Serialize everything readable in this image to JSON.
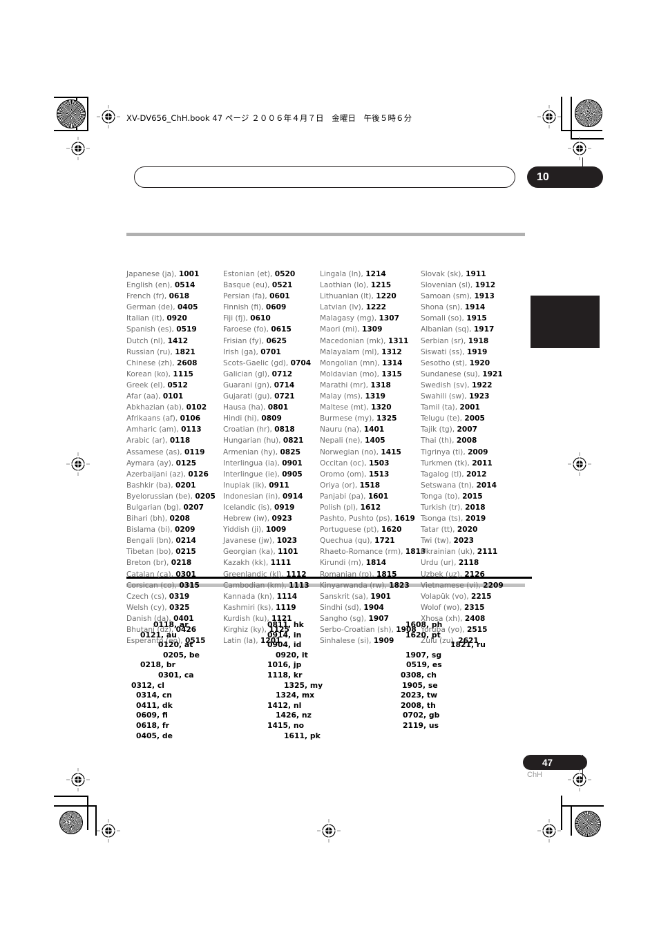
{
  "header": {
    "running_head": "XV-DV656_ChH.book 47 ページ  ２００６年４月７日　金曜日　午後５時６分"
  },
  "chapter": {
    "number": "10",
    "title": ""
  },
  "footer": {
    "page_number": "47",
    "page_lang_code": "ChH"
  },
  "language_table": {
    "columns": [
      {
        "rows": [
          {
            "name": "Japanese (ja), ",
            "code": "1001"
          },
          {
            "name": "English (en), ",
            "code": "0514"
          },
          {
            "name": "French (fr), ",
            "code": "0618"
          },
          {
            "name": "German (de), ",
            "code": "0405"
          },
          {
            "name": "Italian (it), ",
            "code": "0920"
          },
          {
            "name": "Spanish (es), ",
            "code": "0519"
          },
          {
            "name": "Dutch (nl), ",
            "code": "1412"
          },
          {
            "name": "Russian (ru), ",
            "code": "1821"
          },
          {
            "name": "Chinese (zh), ",
            "code": "2608"
          },
          {
            "name": "Korean (ko), ",
            "code": "1115"
          },
          {
            "name": "Greek (el), ",
            "code": "0512"
          },
          {
            "name": "Afar (aa), ",
            "code": "0101"
          },
          {
            "name": "Abkhazian (ab), ",
            "code": "0102"
          },
          {
            "name": "Afrikaans (af), ",
            "code": "0106"
          },
          {
            "name": "Amharic (am), ",
            "code": "0113"
          },
          {
            "name": "Arabic (ar), ",
            "code": "0118"
          },
          {
            "name": "Assamese (as), ",
            "code": "0119"
          },
          {
            "name": "Aymara (ay), ",
            "code": "0125"
          },
          {
            "name": "Azerbaijani (az), ",
            "code": "0126"
          },
          {
            "name": "Bashkir (ba), ",
            "code": "0201"
          },
          {
            "name": "Byelorussian (be), ",
            "code": "0205"
          },
          {
            "name": "Bulgarian (bg), ",
            "code": "0207"
          },
          {
            "name": "Bihari (bh), ",
            "code": "0208"
          },
          {
            "name": "Bislama (bi), ",
            "code": "0209"
          },
          {
            "name": "Bengali (bn), ",
            "code": "0214"
          },
          {
            "name": "Tibetan (bo), ",
            "code": "0215"
          },
          {
            "name": "Breton (br), ",
            "code": "0218"
          },
          {
            "name": "Catalan (ca), ",
            "code": "0301"
          },
          {
            "name": "Corsican (co), ",
            "code": "0315"
          },
          {
            "name": "Czech (cs), ",
            "code": "0319"
          },
          {
            "name": "Welsh (cy), ",
            "code": "0325"
          },
          {
            "name": "Danish (da), ",
            "code": "0401"
          },
          {
            "name": "Bhutani (dz), ",
            "code": "0426"
          },
          {
            "name": "Esperanto (eo), ",
            "code": "0515"
          }
        ]
      },
      {
        "rows": [
          {
            "name": "Estonian (et), ",
            "code": "0520"
          },
          {
            "name": "Basque (eu), ",
            "code": "0521"
          },
          {
            "name": "Persian (fa), ",
            "code": "0601"
          },
          {
            "name": "Finnish (fi), ",
            "code": "0609"
          },
          {
            "name": "Fiji (fj), ",
            "code": "0610"
          },
          {
            "name": "Faroese (fo), ",
            "code": "0615"
          },
          {
            "name": "Frisian (fy), ",
            "code": "0625"
          },
          {
            "name": "Irish (ga), ",
            "code": "0701"
          },
          {
            "name": "Scots-Gaelic (gd), ",
            "code": "0704"
          },
          {
            "name": "Galician (gl), ",
            "code": "0712"
          },
          {
            "name": "Guarani (gn), ",
            "code": "0714"
          },
          {
            "name": "Gujarati (gu), ",
            "code": "0721"
          },
          {
            "name": "Hausa (ha), ",
            "code": "0801"
          },
          {
            "name": "Hindi (hi), ",
            "code": "0809"
          },
          {
            "name": "Croatian (hr), ",
            "code": "0818"
          },
          {
            "name": "Hungarian (hu), ",
            "code": "0821"
          },
          {
            "name": "Armenian (hy), ",
            "code": "0825"
          },
          {
            "name": "Interlingua (ia), ",
            "code": "0901"
          },
          {
            "name": "Interlingue (ie), ",
            "code": "0905"
          },
          {
            "name": "Inupiak (ik), ",
            "code": "0911"
          },
          {
            "name": "Indonesian (in), ",
            "code": "0914"
          },
          {
            "name": "Icelandic (is), ",
            "code": "0919"
          },
          {
            "name": "Hebrew (iw), ",
            "code": "0923"
          },
          {
            "name": "Yiddish (ji), ",
            "code": "1009"
          },
          {
            "name": "Javanese (jw), ",
            "code": "1023"
          },
          {
            "name": "Georgian (ka), ",
            "code": "1101"
          },
          {
            "name": "Kazakh (kk), ",
            "code": "1111"
          },
          {
            "name": "Greenlandic  (kl), ",
            "code": "1112"
          },
          {
            "name": "Cambodian (km), ",
            "code": "1113"
          },
          {
            "name": "Kannada (kn), ",
            "code": "1114"
          },
          {
            "name": "Kashmiri (ks), ",
            "code": "1119"
          },
          {
            "name": "Kurdish (ku), ",
            "code": "1121"
          },
          {
            "name": "Kirghiz (ky), ",
            "code": "1125"
          },
          {
            "name": "Latin (la), ",
            "code": "1201"
          }
        ]
      },
      {
        "rows": [
          {
            "name": "Lingala (ln), ",
            "code": "1214"
          },
          {
            "name": "Laothian (lo), ",
            "code": "1215"
          },
          {
            "name": "Lithuanian (lt), ",
            "code": "1220"
          },
          {
            "name": "Latvian (lv), ",
            "code": "1222"
          },
          {
            "name": "Malagasy (mg), ",
            "code": "1307"
          },
          {
            "name": "Maori (mi), ",
            "code": "1309"
          },
          {
            "name": "Macedonian (mk), ",
            "code": "1311"
          },
          {
            "name": "Malayalam  (ml), ",
            "code": "1312"
          },
          {
            "name": "Mongolian (mn), ",
            "code": "1314"
          },
          {
            "name": "Moldavian (mo), ",
            "code": "1315"
          },
          {
            "name": "Marathi (mr), ",
            "code": "1318"
          },
          {
            "name": "Malay  (ms), ",
            "code": "1319"
          },
          {
            "name": "Maltese (mt), ",
            "code": "1320"
          },
          {
            "name": "Burmese (my), ",
            "code": "1325"
          },
          {
            "name": "Nauru (na), ",
            "code": "1401"
          },
          {
            "name": "Nepali (ne), ",
            "code": "1405"
          },
          {
            "name": "Norwegian (no), ",
            "code": "1415"
          },
          {
            "name": "Occitan (oc), ",
            "code": "1503"
          },
          {
            "name": "Oromo (om), ",
            "code": "1513"
          },
          {
            "name": "Oriya (or), ",
            "code": "1518"
          },
          {
            "name": "Panjabi (pa), ",
            "code": "1601"
          },
          {
            "name": "Polish (pl), ",
            "code": "1612"
          },
          {
            "name": "Pashto, Pushto (ps), ",
            "code": "1619"
          },
          {
            "name": "Portuguese (pt), ",
            "code": "1620"
          },
          {
            "name": "Quechua (qu), ",
            "code": "1721"
          },
          {
            "name": "Rhaeto-Romance (rm), ",
            "code": "1813"
          },
          {
            "name": "Kirundi (rn), ",
            "code": "1814"
          },
          {
            "name": "Romanian (ro), ",
            "code": "1815"
          },
          {
            "name": "Kinyarwanda (rw), ",
            "code": "1823"
          },
          {
            "name": "Sanskrit (sa), ",
            "code": "1901"
          },
          {
            "name": "Sindhi (sd), ",
            "code": "1904"
          },
          {
            "name": "Sangho (sg), ",
            "code": "1907"
          },
          {
            "name": "Serbo-Croatian (sh), ",
            "code": "1908"
          },
          {
            "name": "Sinhalese (si), ",
            "code": "1909"
          }
        ]
      },
      {
        "rows": [
          {
            "name": "Slovak (sk), ",
            "code": "1911"
          },
          {
            "name": "Slovenian (sl), ",
            "code": "1912"
          },
          {
            "name": "Samoan (sm), ",
            "code": "1913"
          },
          {
            "name": "Shona (sn), ",
            "code": "1914"
          },
          {
            "name": "Somali (so), ",
            "code": "1915"
          },
          {
            "name": "Albanian (sq), ",
            "code": "1917"
          },
          {
            "name": "Serbian (sr), ",
            "code": "1918"
          },
          {
            "name": "Siswati (ss), ",
            "code": "1919"
          },
          {
            "name": "Sesotho (st), ",
            "code": "1920"
          },
          {
            "name": "Sundanese (su), ",
            "code": "1921"
          },
          {
            "name": "Swedish (sv), ",
            "code": "1922"
          },
          {
            "name": "Swahili (sw), ",
            "code": "1923"
          },
          {
            "name": "Tamil (ta), ",
            "code": "2001"
          },
          {
            "name": "Telugu (te), ",
            "code": "2005"
          },
          {
            "name": "Tajik (tg), ",
            "code": "2007"
          },
          {
            "name": "Thai (th), ",
            "code": "2008"
          },
          {
            "name": "Tigrinya (ti), ",
            "code": "2009"
          },
          {
            "name": "Turkmen (tk), ",
            "code": "2011"
          },
          {
            "name": "Tagalog (tl), ",
            "code": "2012"
          },
          {
            "name": "Setswana (tn), ",
            "code": "2014"
          },
          {
            "name": "Tonga (to), ",
            "code": "2015"
          },
          {
            "name": "Turkish (tr), ",
            "code": "2018"
          },
          {
            "name": "Tsonga (ts), ",
            "code": "2019"
          },
          {
            "name": "Tatar (tt), ",
            "code": "2020"
          },
          {
            "name": "Twi (tw), ",
            "code": "2023"
          },
          {
            "name": "Ukrainian (uk), ",
            "code": "2111"
          },
          {
            "name": "Urdu (ur), ",
            "code": "2118"
          },
          {
            "name": "Uzbek (uz), ",
            "code": "2126"
          },
          {
            "name": "Vietnamese (vi), ",
            "code": "2209"
          },
          {
            "name": "Volapük (vo), ",
            "code": "2215"
          },
          {
            "name": "Wolof (wo), ",
            "code": "2315"
          },
          {
            "name": "Xhosa (xh), ",
            "code": "2408"
          },
          {
            "name": "Yoruba (yo), ",
            "code": "2515"
          },
          {
            "name": "Zulu (zu), ",
            "code": "2621"
          }
        ]
      }
    ]
  },
  "country_table": {
    "columns": [
      {
        "rows": [
          {
            "text": "0118, ar",
            "indent": 39
          },
          {
            "text": "0121, au",
            "indent": 20
          },
          {
            "text": "0120, at",
            "indent": 46
          },
          {
            "text": "0205, be",
            "indent": 53
          },
          {
            "text": "0218, br",
            "indent": 20
          },
          {
            "text": "0301, ca",
            "indent": 46
          },
          {
            "text": "0312, cl",
            "indent": 7
          },
          {
            "text": "0314, cn",
            "indent": 14
          },
          {
            "text": "0411, dk",
            "indent": 14
          },
          {
            "text": "0609, fi",
            "indent": 14
          },
          {
            "text": "0618, fr",
            "indent": 14
          },
          {
            "text": "0405, de",
            "indent": 14
          }
        ]
      },
      {
        "rows": [
          {
            "text": "0811, hk",
            "indent": 0
          },
          {
            "text": "0914, in",
            "indent": 0
          },
          {
            "text": "0904, id",
            "indent": 0
          },
          {
            "text": "0920, it",
            "indent": 12
          },
          {
            "text": "1016, jp",
            "indent": 0
          },
          {
            "text": "1118, kr",
            "indent": 0
          },
          {
            "text": "1325, my",
            "indent": 24
          },
          {
            "text": "1324, mx",
            "indent": 12
          },
          {
            "text": "1412, nl",
            "indent": 0
          },
          {
            "text": "1426, nz",
            "indent": 12
          },
          {
            "text": "1415, no",
            "indent": 0
          },
          {
            "text": "1611, pk",
            "indent": 24
          }
        ]
      },
      {
        "rows": [
          {
            "text": "1608, ph",
            "indent": 18
          },
          {
            "text": "1620, pt",
            "indent": 18
          },
          {
            "text": "1821, ru",
            "indent": 83
          },
          {
            "text": "1907, sg",
            "indent": 18
          },
          {
            "text": "0519, es",
            "indent": 19
          },
          {
            "text": "0308, ch",
            "indent": 11
          },
          {
            "text": "1905, se",
            "indent": 13
          },
          {
            "text": "2023, tw",
            "indent": 11
          },
          {
            "text": "2008, th",
            "indent": 11
          },
          {
            "text": "0702, gb",
            "indent": 14
          },
          {
            "text": "2119, us",
            "indent": 14
          }
        ]
      }
    ]
  }
}
